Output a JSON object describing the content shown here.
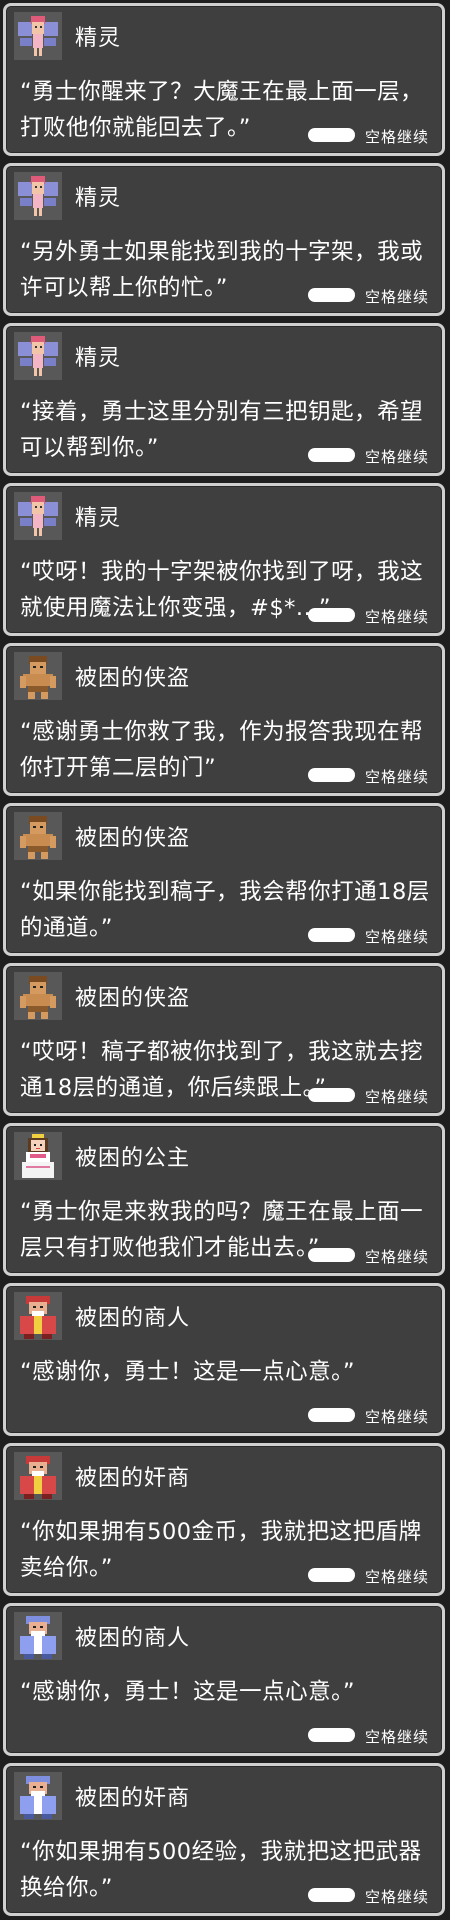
{
  "continue_label": "空格继续",
  "dialogs": [
    {
      "speaker": "精灵",
      "portrait": "fairy-icon",
      "text": "“勇士你醒来了？大魔王在最上面一层，打败他你就能回去了。”"
    },
    {
      "speaker": "精灵",
      "portrait": "fairy-icon",
      "text": "“另外勇士如果能找到我的十字架，我或许可以帮上你的忙。”"
    },
    {
      "speaker": "精灵",
      "portrait": "fairy-icon",
      "text": "“接着，勇士这里分别有三把钥匙，希望可以帮到你。”"
    },
    {
      "speaker": "精灵",
      "portrait": "fairy-icon",
      "text": "“哎呀！我的十字架被你找到了呀，我这就使用魔法让你变强，#$*...”"
    },
    {
      "speaker": "被困的侠盗",
      "portrait": "thief-icon",
      "text": "“感谢勇士你救了我，作为报答我现在帮你打开第二层的门”"
    },
    {
      "speaker": "被困的侠盗",
      "portrait": "thief-icon",
      "text": "“如果你能找到稿子，我会帮你打通18层的通道。”"
    },
    {
      "speaker": "被困的侠盗",
      "portrait": "thief-icon",
      "text": "“哎呀！稿子都被你找到了，我这就去挖通18层的通道，你后续跟上。”"
    },
    {
      "speaker": "被困的公主",
      "portrait": "princess-icon",
      "text": "“勇士你是来救我的吗？魔王在最上面一层只有打败他我们才能出去。”"
    },
    {
      "speaker": "被困的商人",
      "portrait": "red-merchant-icon",
      "text": "“感谢你，勇士！这是一点心意。”"
    },
    {
      "speaker": "被困的奸商",
      "portrait": "red-merchant-icon",
      "text": "“你如果拥有500金币，我就把这把盾牌卖给你。”"
    },
    {
      "speaker": "被困的商人",
      "portrait": "blue-merchant-icon",
      "text": "“感谢你，勇士！这是一点心意。”"
    },
    {
      "speaker": "被困的奸商",
      "portrait": "blue-merchant-icon",
      "text": "“你如果拥有500经验，我就把这把武器换给你。”"
    }
  ]
}
